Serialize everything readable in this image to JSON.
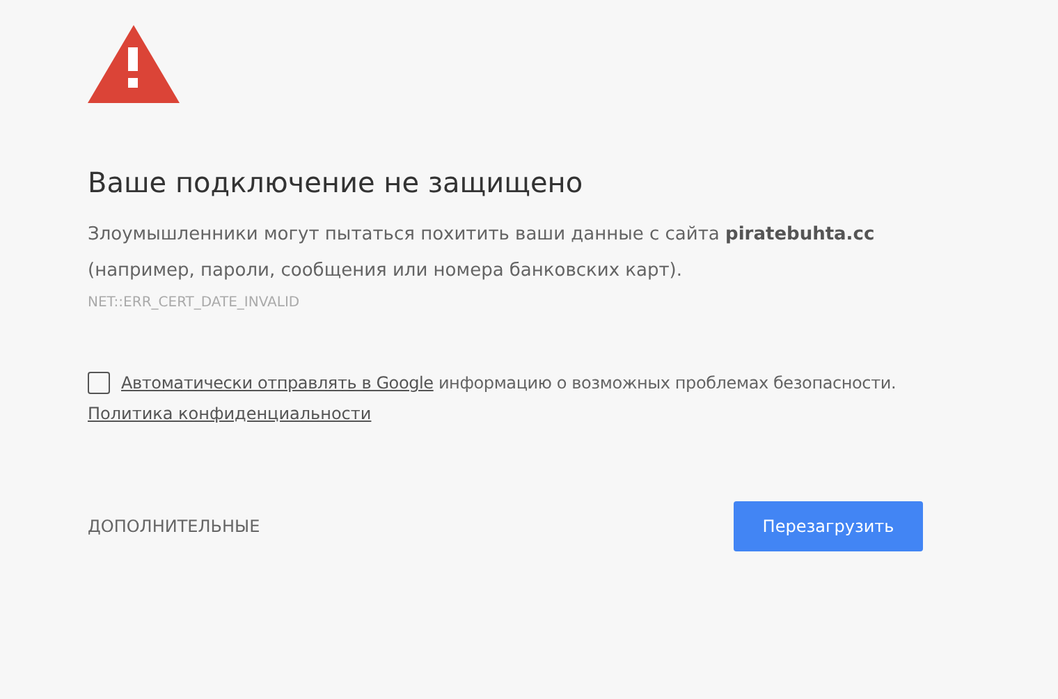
{
  "heading": "Ваше подключение не защищено",
  "explanation": "Злоумышленники могут пытаться похитить ваши данные с сайта **piratebuhta.cc** (например, пароли, сообщения или номера банковских карт).",
  "error_code": "NET::ERR_CERT_DATE_INVALID",
  "report_option": {
    "checked": false,
    "link": "Автоматически отправлять в Google",
    "text": "информацию о возможных проблемах безопасности."
  },
  "privacy_link": "Политика конфиденциальности",
  "advanced_button": "ДОПОЛНИТЕЛЬНЫЕ",
  "reload_button": "Перезагрузить"
}
